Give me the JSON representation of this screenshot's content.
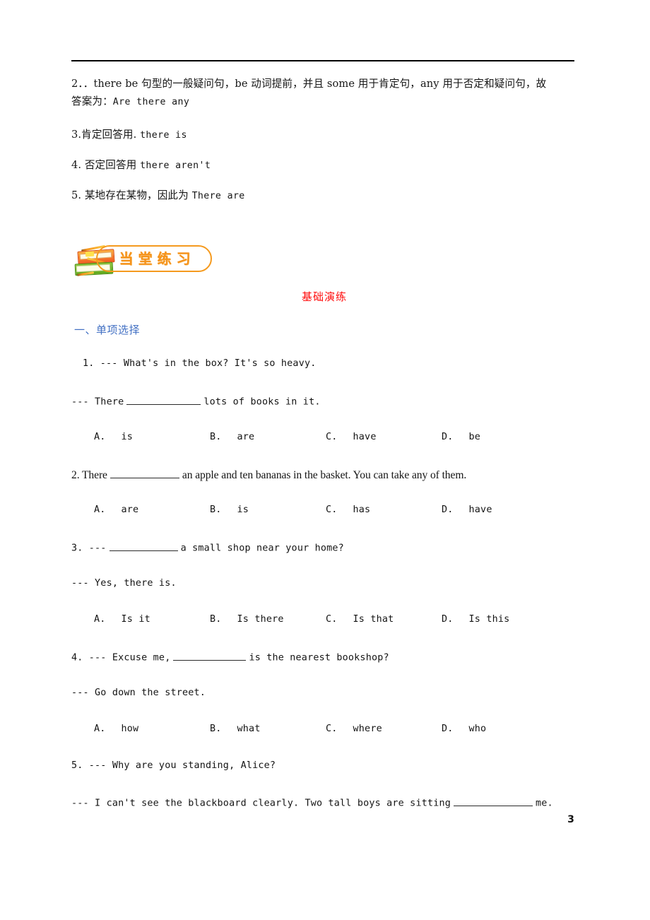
{
  "document": {
    "page_number": "3",
    "colors": {
      "heading_red": "#FF0A0A",
      "heading_blue": "#4472C4",
      "banner_orange": "#F5931C",
      "rule_black": "#000000"
    }
  },
  "explanations": [
    {
      "id": "item-2",
      "line1": "2．．there be 句型的一般疑问句，be 动词提前，并且 some 用于肯定句，any 用于否定和疑问句，故",
      "line2_prefix": "答案为：",
      "line2_en": "Are there any"
    },
    {
      "id": "item-3",
      "cn": "3.肯定回答用.",
      "en": "there is"
    },
    {
      "id": "item-4",
      "cn": "4. 否定回答用",
      "en": "there aren't"
    },
    {
      "id": "item-5",
      "cn": "5. 某地存在某物，因此为",
      "en": "There are"
    }
  ],
  "banner": {
    "title": "当堂练习",
    "icon": "stacked-books-icon"
  },
  "sections": {
    "subtitle_red": "基础演练",
    "part_one_heading": "一、单项选择"
  },
  "questions": [
    {
      "number": "1",
      "stem_line1": "1. --- What's in the box? It's so heavy.",
      "stem_line2_before": "--- There",
      "stem_line2_after": "lots of books in it.",
      "options": [
        {
          "letter": "A.",
          "value": "is"
        },
        {
          "letter": "B.",
          "value": "are"
        },
        {
          "letter": "C.",
          "value": "have"
        },
        {
          "letter": "D.",
          "value": "be"
        }
      ]
    },
    {
      "number": "2",
      "stem_before": "2. There",
      "stem_after": "an apple and ten bananas in the basket. You can take any of them.",
      "options": [
        {
          "letter": "A.",
          "value": "are"
        },
        {
          "letter": "B.",
          "value": "is"
        },
        {
          "letter": "C.",
          "value": "has"
        },
        {
          "letter": "D.",
          "value": "have"
        }
      ]
    },
    {
      "number": "3",
      "stem_before": "3. ---",
      "stem_after": "a small shop near your home?",
      "stem_line2": "--- Yes, there is.",
      "options": [
        {
          "letter": "A.",
          "value": "Is it"
        },
        {
          "letter": "B.",
          "value": "Is there"
        },
        {
          "letter": "C.",
          "value": "Is that"
        },
        {
          "letter": "D.",
          "value": "Is this"
        }
      ]
    },
    {
      "number": "4",
      "stem_before": "4. --- Excuse me,",
      "stem_after": "is the nearest bookshop?",
      "stem_line2": "--- Go down the street.",
      "options": [
        {
          "letter": "A.",
          "value": "how"
        },
        {
          "letter": "B.",
          "value": "what"
        },
        {
          "letter": "C.",
          "value": "where"
        },
        {
          "letter": "D.",
          "value": "who"
        }
      ]
    },
    {
      "number": "5",
      "stem_line1": "5. --- Why are you standing, Alice?",
      "stem_line2_before": "--- I can't see the blackboard clearly. Two tall boys are sitting",
      "stem_line2_after": "me."
    }
  ]
}
